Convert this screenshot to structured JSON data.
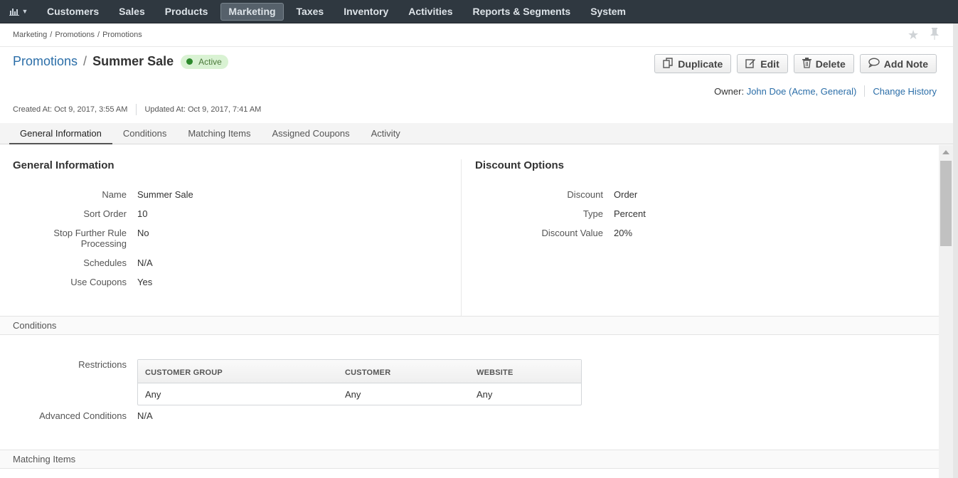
{
  "nav": {
    "logo_icon": "bar-chart-icon",
    "items": [
      "Customers",
      "Sales",
      "Products",
      "Marketing",
      "Taxes",
      "Inventory",
      "Activities",
      "Reports & Segments",
      "System"
    ],
    "active": "Marketing"
  },
  "breadcrumb": [
    "Marketing",
    "Promotions",
    "Promotions"
  ],
  "header": {
    "entity_link": "Promotions",
    "separator": "/",
    "name": "Summer Sale",
    "status": "Active",
    "status_color": "#2d8a2d"
  },
  "actions": {
    "duplicate": "Duplicate",
    "edit": "Edit",
    "delete": "Delete",
    "add_note": "Add Note"
  },
  "owner": {
    "label": "Owner:",
    "name": "John Doe",
    "open_paren": "(",
    "org1": "Acme",
    "comma": ",",
    "org2": "General",
    "close_paren": ")",
    "history_link": "Change History"
  },
  "meta": {
    "created": "Created At: Oct 9, 2017, 3:55 AM",
    "updated": "Updated At: Oct 9, 2017, 7:41 AM"
  },
  "tabs": [
    "General Information",
    "Conditions",
    "Matching Items",
    "Assigned Coupons",
    "Activity"
  ],
  "general": {
    "title": "General Information",
    "fields": [
      {
        "label": "Name",
        "value": "Summer Sale"
      },
      {
        "label": "Sort Order",
        "value": "10"
      },
      {
        "label": "Stop Further Rule Processing",
        "value": "No"
      },
      {
        "label": "Schedules",
        "value": "N/A"
      },
      {
        "label": "Use Coupons",
        "value": "Yes"
      }
    ]
  },
  "discount": {
    "title": "Discount Options",
    "fields": [
      {
        "label": "Discount",
        "value": "Order"
      },
      {
        "label": "Type",
        "value": "Percent"
      },
      {
        "label": "Discount Value",
        "value": "20%"
      }
    ]
  },
  "conditions": {
    "band_title": "Conditions",
    "restrictions_label": "Restrictions",
    "columns": [
      "CUSTOMER GROUP",
      "CUSTOMER",
      "WEBSITE"
    ],
    "row": [
      "Any",
      "Any",
      "Any"
    ],
    "advanced_label": "Advanced Conditions",
    "advanced_value": "N/A"
  },
  "matching": {
    "band_title": "Matching Items"
  }
}
